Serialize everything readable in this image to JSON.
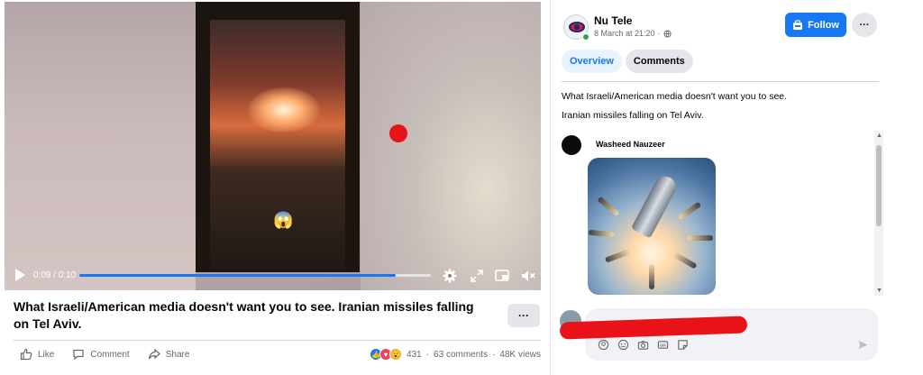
{
  "video": {
    "time_display": "0:09 / 0:10",
    "progress": 0.9,
    "overlay_emoji": "😱"
  },
  "post": {
    "title": "What Israeli/American media doesn't want you to see. Iranian missiles falling on Tel Aviv.",
    "more_label": "···",
    "actions": {
      "like": "Like",
      "comment": "Comment",
      "share": "Share"
    },
    "reaction_count": "431",
    "separator": "·",
    "comments_count": "63 comments",
    "views_count": "48K views"
  },
  "panel": {
    "page_name": "Nu Tele",
    "post_date": "8 March at 21:20",
    "meta_dot": "·",
    "follow_label": "Follow",
    "more_label": "···",
    "tabs": [
      {
        "label": "Overview",
        "active": true
      },
      {
        "label": "Comments",
        "active": false
      }
    ],
    "description": [
      "What Israeli/American media doesn't want you to see.",
      "Iranian missiles falling on Tel Aviv."
    ],
    "comment": {
      "author": "Washeed Nauzeer"
    }
  },
  "colors": {
    "accent": "#1877f2",
    "redaction": "#ea1219",
    "online": "#31a24c"
  },
  "icons": [
    "play-icon",
    "settings-gear-icon",
    "expand-icon",
    "miniplayer-icon",
    "volume-muted-icon",
    "like-thumb-icon",
    "comment-bubble-icon",
    "share-arrow-icon",
    "globe-icon",
    "follow-page-icon",
    "avatar-sticker-icon",
    "emoji-icon",
    "camera-icon",
    "gif-icon",
    "sticker-icon",
    "send-icon"
  ]
}
